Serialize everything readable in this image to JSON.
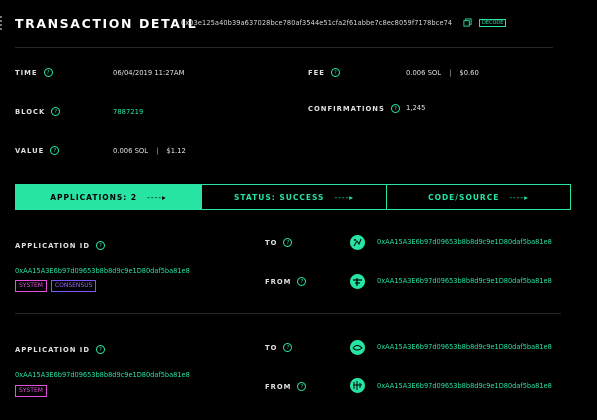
{
  "header": {
    "title": "TRANSACTION DETAIL",
    "hash": "0x03e125a40b39a637028bce780af3544e51cfa2f61abbe7c8ec8059f7178bce74",
    "badge": "DECODE"
  },
  "summary": {
    "time_label": "TIME",
    "time_value": "06/04/2019 11:27AM",
    "fee_label": "FEE",
    "fee_sol": "0.006 SOL",
    "fee_usd": "$0.60",
    "block_label": "BLOCK",
    "block_value": "7887219",
    "confirmations_label": "CONFIRMATIONS",
    "confirmations_value": "1,245",
    "value_label": "VALUE",
    "value_sol": "0.006 SOL",
    "value_usd": "$1.12",
    "separator": "|",
    "help_glyph": "?"
  },
  "tabs": [
    {
      "label": "APPLICATIONS: 2",
      "arrow": "----▸",
      "active": true
    },
    {
      "label": "STATUS: SUCCESS",
      "arrow": "----▸",
      "active": false
    },
    {
      "label": "CODE/SOURCE",
      "arrow": "----▸",
      "active": false
    }
  ],
  "applications": [
    {
      "id_label": "APPLICATION ID",
      "id": "0xAA15A3E6b97d09653b8b8d9c9e1D80daf5ba81e8",
      "tags": [
        "SYSTEM",
        "CONSENSUS"
      ],
      "to_label": "TO",
      "to_addr": "0xAA15A3E6b97d09653b8b8d9c9e1D80daf5ba81e8",
      "from_label": "FROM",
      "from_addr": "0xAA15A3E6b97d09653b8b8d9c9e1D80daf5ba81e8"
    },
    {
      "id_label": "APPLICATION ID",
      "id": "0xAA15A3E6b97d09653b8b8d9c9e1D80daf5ba81e8",
      "tags": [
        "SYSTEM"
      ],
      "to_label": "TO",
      "to_addr": "0xAA15A3E6b97d09653b8b8d9c9e1D80daf5ba81e8",
      "from_label": "FROM",
      "from_addr": "0xAA15A3E6b97d09653b8b8d9c9e1D80daf5ba81e8"
    }
  ],
  "colors": {
    "accent": "#27e4a3",
    "system": "#e252d8",
    "consensus": "#9a6bff",
    "background": "#000000"
  }
}
